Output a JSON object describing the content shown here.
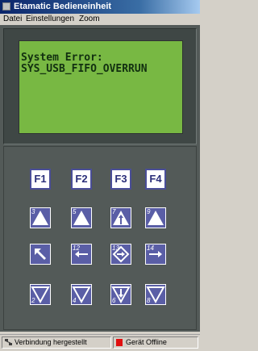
{
  "window": {
    "title": "Etamatic Bedieneinheit"
  },
  "menu": {
    "items": [
      {
        "label": "Datei"
      },
      {
        "label": "Einstellungen"
      },
      {
        "label": "Zoom"
      }
    ]
  },
  "display": {
    "lines": [
      "System Error:",
      "SYS_USB_FIFO_OVERRUN"
    ],
    "color": "#78b843"
  },
  "function_keys": [
    {
      "label": "F1"
    },
    {
      "label": "F2"
    },
    {
      "label": "F3"
    },
    {
      "label": "F4"
    }
  ],
  "keys": [
    {
      "icon": "up-triangle-icon",
      "number": "3"
    },
    {
      "icon": "up-triangle-icon",
      "number": "5"
    },
    {
      "icon": "up-arrow-triangle-icon",
      "number": "7"
    },
    {
      "icon": "up-triangle-icon",
      "number": "9"
    },
    {
      "icon": "diagonal-arrow-icon",
      "number": ""
    },
    {
      "icon": "left-arrow-icon",
      "number": "12"
    },
    {
      "icon": "enter-arrow-icon",
      "number": "13"
    },
    {
      "icon": "right-arrow-icon",
      "number": "14"
    },
    {
      "icon": "down-triangle-icon",
      "number": "2"
    },
    {
      "icon": "down-triangle-icon",
      "number": "4"
    },
    {
      "icon": "down-arrow-triangle-icon",
      "number": "6"
    },
    {
      "icon": "down-triangle-icon",
      "number": "8"
    }
  ],
  "status": {
    "connection": "Verbindung hergestellt",
    "device": "Gerät Offline",
    "device_color": "#e01010"
  }
}
